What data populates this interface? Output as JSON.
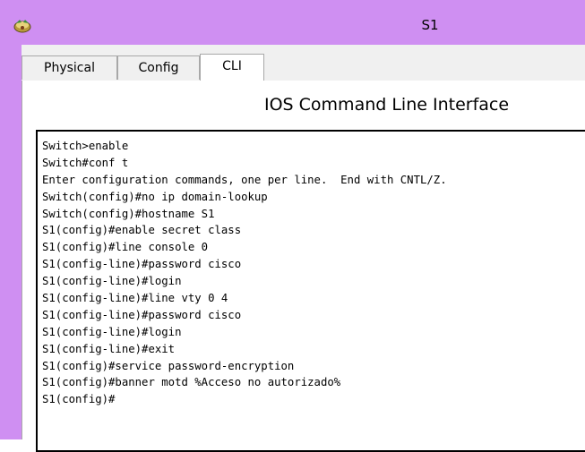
{
  "window": {
    "title": "S1",
    "icon": "network-device-icon"
  },
  "tabs": [
    {
      "label": "Physical",
      "active": false
    },
    {
      "label": "Config",
      "active": false
    },
    {
      "label": "CLI",
      "active": true
    }
  ],
  "cli": {
    "heading": "IOS Command Line Interface",
    "lines": [
      "Switch>enable",
      "Switch#conf t",
      "Enter configuration commands, one per line.  End with CNTL/Z.",
      "Switch(config)#no ip domain-lookup",
      "Switch(config)#hostname S1",
      "S1(config)#enable secret class",
      "S1(config)#line console 0",
      "S1(config-line)#password cisco",
      "S1(config-line)#login",
      "S1(config-line)#line vty 0 4",
      "S1(config-line)#password cisco",
      "S1(config-line)#login",
      "S1(config-line)#exit",
      "S1(config)#service password-encryption",
      "S1(config)#banner motd %Acceso no autorizado%",
      "S1(config)#"
    ]
  },
  "colors": {
    "window_frame": "#cf8ff2",
    "content_bg": "#f0f0f0",
    "terminal_bg": "#ffffff"
  }
}
